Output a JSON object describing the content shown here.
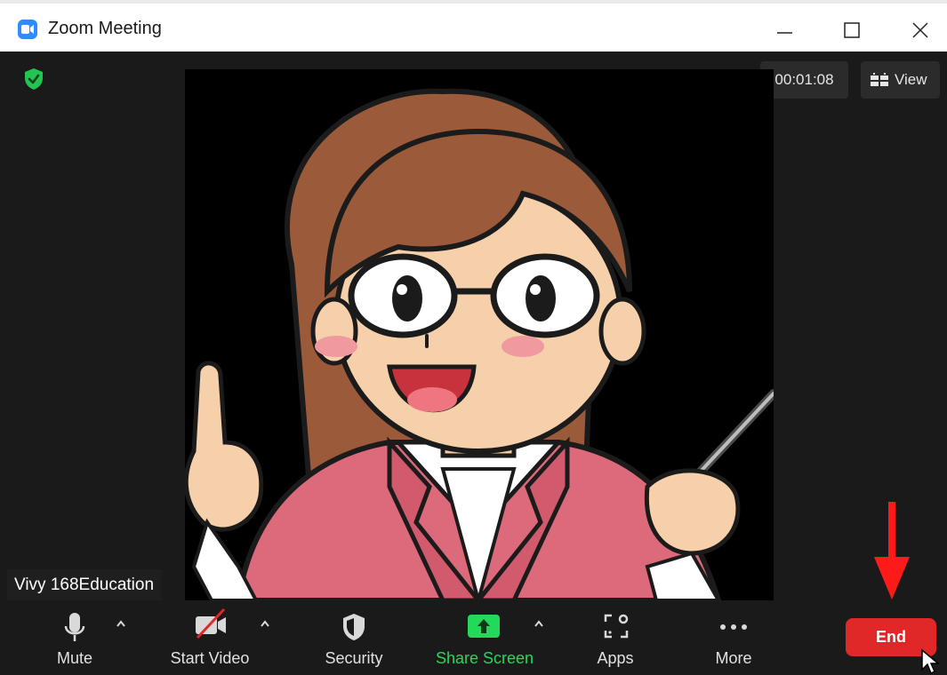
{
  "window": {
    "title": "Zoom Meeting",
    "controls": [
      "minimize",
      "maximize",
      "close"
    ]
  },
  "meeting": {
    "timer": "00:01:08",
    "view_label": "View",
    "participant_name": "Vivy 168Education",
    "encryption_status_color": "#23c552"
  },
  "toolbar": {
    "mute_label": "Mute",
    "start_video_label": "Start Video",
    "security_label": "Security",
    "share_screen_label": "Share Screen",
    "apps_label": "Apps",
    "more_label": "More",
    "end_label": "End"
  },
  "colors": {
    "accent_blue": "#2d8cff",
    "share_green": "#23d959",
    "end_red": "#e02828",
    "annotation_arrow_red": "#ff1a1a"
  },
  "icons": {
    "app": "zoom-camera-icon",
    "encryption": "shield-check-icon",
    "view": "grid-view-icon",
    "mute": "microphone-icon",
    "video": "video-off-icon",
    "security": "security-shield-icon",
    "share": "share-screen-arrow-icon",
    "apps": "apps-icon",
    "more": "ellipsis-icon"
  }
}
